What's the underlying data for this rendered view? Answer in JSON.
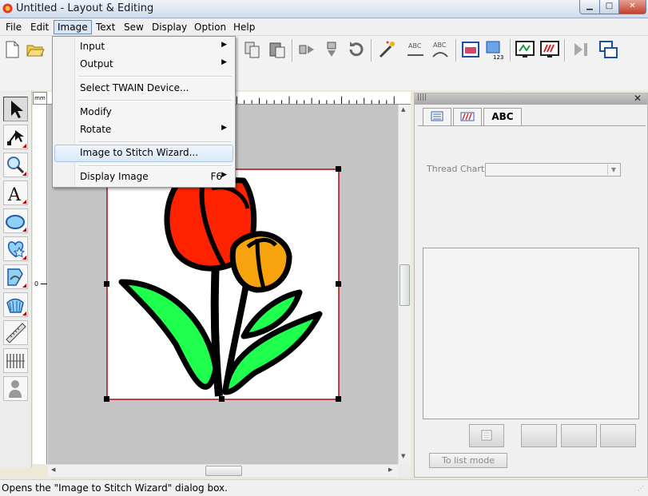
{
  "window": {
    "title": "Untitled - Layout & Editing"
  },
  "menubar": {
    "items": [
      "File",
      "Edit",
      "Image",
      "Text",
      "Sew",
      "Display",
      "Option",
      "Help"
    ],
    "active": "Image"
  },
  "image_menu": {
    "items": [
      {
        "label": "Input",
        "submenu": true
      },
      {
        "label": "Output",
        "submenu": true
      },
      {
        "label": "Select TWAIN Device...",
        "submenu": false
      },
      {
        "label": "Modify",
        "submenu": false
      },
      {
        "label": "Rotate",
        "submenu": true
      },
      {
        "label": "Image to Stitch Wizard...",
        "submenu": false,
        "highlighted": true
      },
      {
        "label": "Display Image",
        "shortcut": "F6",
        "submenu": true
      }
    ]
  },
  "ruler": {
    "unit": "mm",
    "left_zero": "0"
  },
  "right_panel": {
    "tabs": [
      "",
      "",
      "ABC"
    ],
    "thread_chart_label": "Thread Chart:",
    "thread_chart_value": "",
    "list_mode_button": "To list mode"
  },
  "status_bar": {
    "text": "Opens the \"Image to Stitch Wizard\" dialog box."
  },
  "colors": {
    "petal_red": "#ff2200",
    "petal_orange": "#f7a30e",
    "leaf_green": "#1fff4e",
    "outline": "#000000",
    "selection": "#b4060f"
  },
  "icons": {
    "toolbar": [
      "new-file-icon",
      "open-folder-icon",
      "copy-icon",
      "paste-icon",
      "mirror-horizontal-icon",
      "mirror-vertical-icon",
      "rotate-icon",
      "magic-wand-icon",
      "text-on-path-icon",
      "text-arc-icon",
      "design-page-icon",
      "numbered-layout-icon",
      "stitch-simulator-icon",
      "realistic-preview-icon",
      "sew-forward-icon",
      "window-switch-icon"
    ],
    "palette": [
      "select-arrow-icon",
      "point-edit-icon",
      "zoom-icon",
      "text-icon",
      "shape-icon",
      "stamp-icon",
      "manual-punch-icon",
      "outline-icon",
      "measure-icon",
      "stitch-pattern-icon",
      "figure-icon"
    ]
  }
}
